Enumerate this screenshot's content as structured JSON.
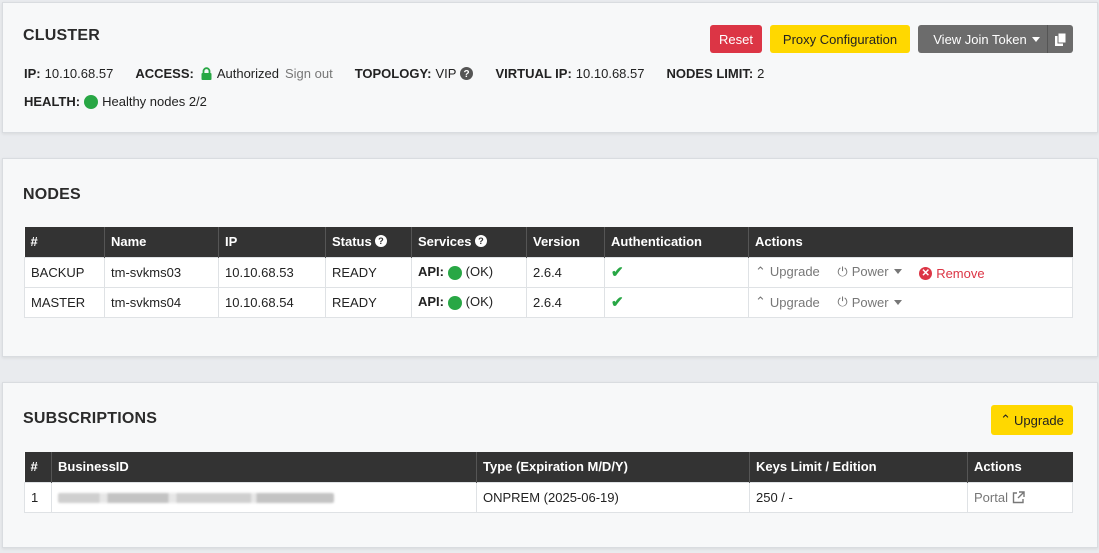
{
  "cluster": {
    "title": "CLUSTER",
    "ip_label": "IP:",
    "ip_value": "10.10.68.57",
    "access_label": "ACCESS:",
    "access_value": "Authorized",
    "signout": "Sign out",
    "topology_label": "TOPOLOGY:",
    "topology_value": "VIP",
    "virtual_ip_label": "VIRTUAL IP:",
    "virtual_ip_value": "10.10.68.57",
    "nodes_limit_label": "NODES LIMIT:",
    "nodes_limit_value": "2",
    "health_label": "HEALTH:",
    "health_value": "Healthy nodes 2/2",
    "buttons": {
      "reset": "Reset",
      "proxy": "Proxy Configuration",
      "join_token": "View Join Token"
    }
  },
  "nodes": {
    "title": "NODES",
    "headers": [
      "#",
      "Name",
      "IP",
      "Status",
      "Services",
      "Version",
      "Authentication",
      "Actions"
    ],
    "rows": [
      {
        "num": "BACKUP",
        "name": "tm-svkms03",
        "ip": "10.10.68.53",
        "status": "READY",
        "api_label": "API:",
        "api_status": "(OK)",
        "version": "2.6.4",
        "upgrade": "Upgrade",
        "power": "Power",
        "remove": "Remove"
      },
      {
        "num": "MASTER",
        "name": "tm-svkms04",
        "ip": "10.10.68.54",
        "status": "READY",
        "api_label": "API:",
        "api_status": "(OK)",
        "version": "2.6.4",
        "upgrade": "Upgrade",
        "power": "Power"
      }
    ]
  },
  "subscriptions": {
    "title": "SUBSCRIPTIONS",
    "upgrade_button": "Upgrade",
    "headers": [
      "#",
      "BusinessID",
      "Type (Expiration M/D/Y)",
      "Keys Limit / Edition",
      "Actions"
    ],
    "rows": [
      {
        "num": "1",
        "type": "ONPREM (2025-06-19)",
        "keys": "250 / -",
        "action": "Portal"
      }
    ]
  },
  "colors": {
    "danger": "#dc3545",
    "warning": "#ffd800",
    "success": "#28a745",
    "dark": "#333333"
  }
}
